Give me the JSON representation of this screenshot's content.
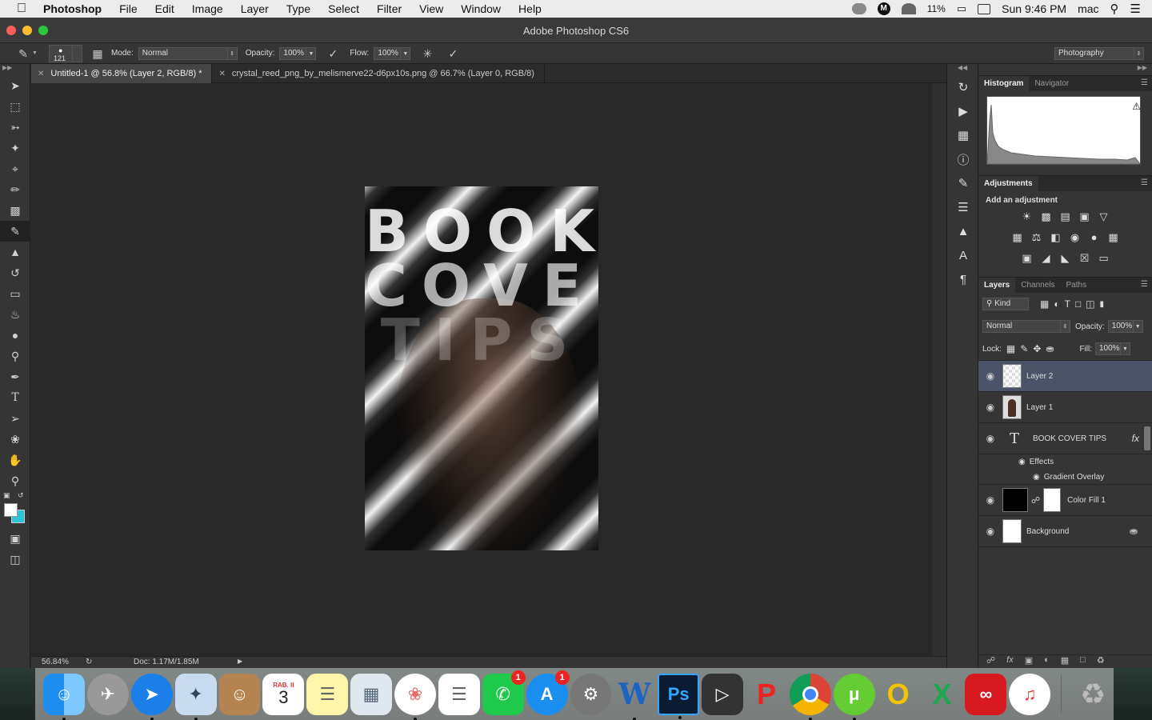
{
  "menubar": {
    "app": "Photoshop",
    "items": [
      "File",
      "Edit",
      "Image",
      "Layer",
      "Type",
      "Select",
      "Filter",
      "View",
      "Window",
      "Help"
    ],
    "battery": "11%",
    "clock": "Sun 9:46 PM",
    "user": "mac",
    "m_badge": "M"
  },
  "window": {
    "title": "Adobe Photoshop CS6"
  },
  "options": {
    "brush_size": "121",
    "mode_label": "Mode:",
    "mode_value": "Normal",
    "opacity_label": "Opacity:",
    "opacity_value": "100%",
    "flow_label": "Flow:",
    "flow_value": "100%",
    "workspace": "Photography"
  },
  "tabs": [
    {
      "label": "Untitled-1 @ 56.8% (Layer 2, RGB/8) *"
    },
    {
      "label": "crystal_reed_png_by_melismerve22-d6px10s.png @ 66.7% (Layer 0, RGB/8)"
    }
  ],
  "canvas": {
    "line1": "BOOK",
    "line2": "COVER",
    "line3": "TIPS"
  },
  "status": {
    "zoom": "56.84%",
    "doc": "Doc: 1.17M/1.85M"
  },
  "panels": {
    "histogram_tab": "Histogram",
    "navigator_tab": "Navigator",
    "adjustments_tab": "Adjustments",
    "add_adjustment": "Add an adjustment",
    "layers_tab": "Layers",
    "channels_tab": "Channels",
    "paths_tab": "Paths",
    "kind": "Kind",
    "blend_mode": "Normal",
    "opacity_label": "Opacity:",
    "opacity_value": "100%",
    "lock_label": "Lock:",
    "fill_label": "Fill:",
    "fill_value": "100%"
  },
  "layers": [
    {
      "name": "Layer 2"
    },
    {
      "name": "Layer 1"
    },
    {
      "name": "BOOK COVER TIPS"
    },
    {
      "name": "Effects"
    },
    {
      "name": "Gradient Overlay"
    },
    {
      "name": "Color Fill 1"
    },
    {
      "name": "Background"
    }
  ],
  "dock": {
    "calendar_month": "RAB. II",
    "calendar_day": "3",
    "facetime_badge": "1",
    "appstore_badge": "1",
    "word_letter": "W",
    "ps_letter": "Ps"
  },
  "colors": {
    "accent_layer": "#4a5368",
    "ui_dark": "#353535",
    "canvas_bg": "#282828"
  }
}
